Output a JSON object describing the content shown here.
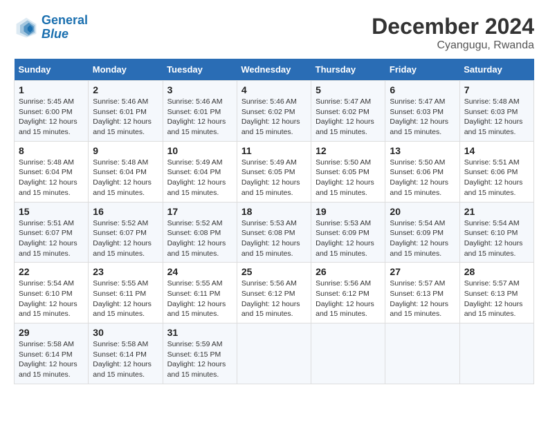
{
  "header": {
    "logo_line1": "General",
    "logo_line2": "Blue",
    "month": "December 2024",
    "location": "Cyangugu, Rwanda"
  },
  "days_of_week": [
    "Sunday",
    "Monday",
    "Tuesday",
    "Wednesday",
    "Thursday",
    "Friday",
    "Saturday"
  ],
  "weeks": [
    [
      {
        "day": "1",
        "info": "Sunrise: 5:45 AM\nSunset: 6:00 PM\nDaylight: 12 hours and 15 minutes."
      },
      {
        "day": "2",
        "info": "Sunrise: 5:46 AM\nSunset: 6:01 PM\nDaylight: 12 hours and 15 minutes."
      },
      {
        "day": "3",
        "info": "Sunrise: 5:46 AM\nSunset: 6:01 PM\nDaylight: 12 hours and 15 minutes."
      },
      {
        "day": "4",
        "info": "Sunrise: 5:46 AM\nSunset: 6:02 PM\nDaylight: 12 hours and 15 minutes."
      },
      {
        "day": "5",
        "info": "Sunrise: 5:47 AM\nSunset: 6:02 PM\nDaylight: 12 hours and 15 minutes."
      },
      {
        "day": "6",
        "info": "Sunrise: 5:47 AM\nSunset: 6:03 PM\nDaylight: 12 hours and 15 minutes."
      },
      {
        "day": "7",
        "info": "Sunrise: 5:48 AM\nSunset: 6:03 PM\nDaylight: 12 hours and 15 minutes."
      }
    ],
    [
      {
        "day": "8",
        "info": "Sunrise: 5:48 AM\nSunset: 6:04 PM\nDaylight: 12 hours and 15 minutes."
      },
      {
        "day": "9",
        "info": "Sunrise: 5:48 AM\nSunset: 6:04 PM\nDaylight: 12 hours and 15 minutes."
      },
      {
        "day": "10",
        "info": "Sunrise: 5:49 AM\nSunset: 6:04 PM\nDaylight: 12 hours and 15 minutes."
      },
      {
        "day": "11",
        "info": "Sunrise: 5:49 AM\nSunset: 6:05 PM\nDaylight: 12 hours and 15 minutes."
      },
      {
        "day": "12",
        "info": "Sunrise: 5:50 AM\nSunset: 6:05 PM\nDaylight: 12 hours and 15 minutes."
      },
      {
        "day": "13",
        "info": "Sunrise: 5:50 AM\nSunset: 6:06 PM\nDaylight: 12 hours and 15 minutes."
      },
      {
        "day": "14",
        "info": "Sunrise: 5:51 AM\nSunset: 6:06 PM\nDaylight: 12 hours and 15 minutes."
      }
    ],
    [
      {
        "day": "15",
        "info": "Sunrise: 5:51 AM\nSunset: 6:07 PM\nDaylight: 12 hours and 15 minutes."
      },
      {
        "day": "16",
        "info": "Sunrise: 5:52 AM\nSunset: 6:07 PM\nDaylight: 12 hours and 15 minutes."
      },
      {
        "day": "17",
        "info": "Sunrise: 5:52 AM\nSunset: 6:08 PM\nDaylight: 12 hours and 15 minutes."
      },
      {
        "day": "18",
        "info": "Sunrise: 5:53 AM\nSunset: 6:08 PM\nDaylight: 12 hours and 15 minutes."
      },
      {
        "day": "19",
        "info": "Sunrise: 5:53 AM\nSunset: 6:09 PM\nDaylight: 12 hours and 15 minutes."
      },
      {
        "day": "20",
        "info": "Sunrise: 5:54 AM\nSunset: 6:09 PM\nDaylight: 12 hours and 15 minutes."
      },
      {
        "day": "21",
        "info": "Sunrise: 5:54 AM\nSunset: 6:10 PM\nDaylight: 12 hours and 15 minutes."
      }
    ],
    [
      {
        "day": "22",
        "info": "Sunrise: 5:54 AM\nSunset: 6:10 PM\nDaylight: 12 hours and 15 minutes."
      },
      {
        "day": "23",
        "info": "Sunrise: 5:55 AM\nSunset: 6:11 PM\nDaylight: 12 hours and 15 minutes."
      },
      {
        "day": "24",
        "info": "Sunrise: 5:55 AM\nSunset: 6:11 PM\nDaylight: 12 hours and 15 minutes."
      },
      {
        "day": "25",
        "info": "Sunrise: 5:56 AM\nSunset: 6:12 PM\nDaylight: 12 hours and 15 minutes."
      },
      {
        "day": "26",
        "info": "Sunrise: 5:56 AM\nSunset: 6:12 PM\nDaylight: 12 hours and 15 minutes."
      },
      {
        "day": "27",
        "info": "Sunrise: 5:57 AM\nSunset: 6:13 PM\nDaylight: 12 hours and 15 minutes."
      },
      {
        "day": "28",
        "info": "Sunrise: 5:57 AM\nSunset: 6:13 PM\nDaylight: 12 hours and 15 minutes."
      }
    ],
    [
      {
        "day": "29",
        "info": "Sunrise: 5:58 AM\nSunset: 6:14 PM\nDaylight: 12 hours and 15 minutes."
      },
      {
        "day": "30",
        "info": "Sunrise: 5:58 AM\nSunset: 6:14 PM\nDaylight: 12 hours and 15 minutes."
      },
      {
        "day": "31",
        "info": "Sunrise: 5:59 AM\nSunset: 6:15 PM\nDaylight: 12 hours and 15 minutes."
      },
      null,
      null,
      null,
      null
    ]
  ]
}
